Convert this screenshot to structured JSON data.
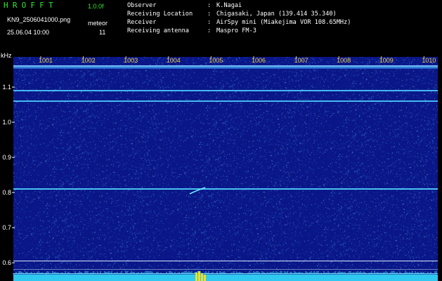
{
  "header": {
    "app_title": "HROFFT",
    "version": "1.0.0f",
    "file_name": "KN9_2506041000.png",
    "mode_label": "meteor",
    "timestamp": "25.06.04 10:00",
    "mode_value": "11"
  },
  "metadata": [
    {
      "key": "Observer",
      "value": "K.Nagai"
    },
    {
      "key": "Receiving Location",
      "value": "Chigasaki, Japan (139.414 35.340)"
    },
    {
      "key": "Receiver",
      "value": "AirSpy mini (Miakejima VOR 108.65MHz)"
    },
    {
      "key": "Receiving antenna",
      "value": "Maspro FM-3"
    }
  ],
  "separator": ":",
  "axes": {
    "y_unit": "kHz",
    "y_ticks": [
      "1.1",
      "1.0",
      "0.9",
      "0.8",
      "0.7",
      "0.6"
    ],
    "x_ticks": [
      "1001",
      "1002",
      "1003",
      "1004",
      "1005",
      "1006",
      "1007",
      "1008",
      "1009",
      "1010"
    ]
  },
  "colors": {
    "background": "#000000",
    "waterfall": "#0a1686",
    "title_green": "#30e830",
    "tick_yellow": "#f0d040",
    "signal_cyan": "#2ec8f0"
  }
}
